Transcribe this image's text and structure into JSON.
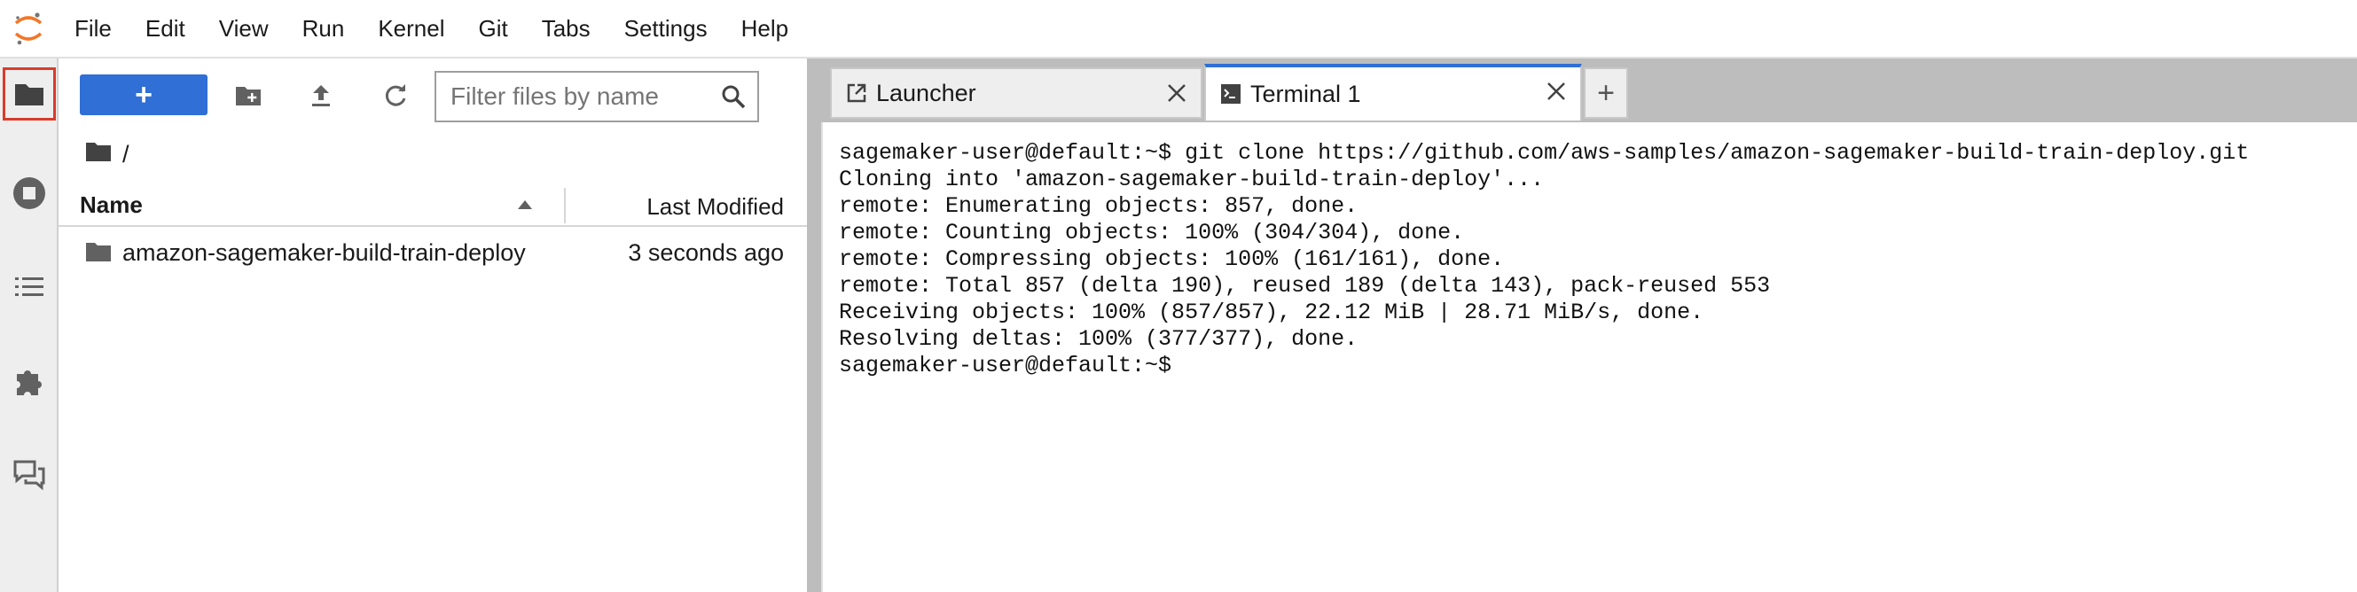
{
  "menu": [
    "File",
    "Edit",
    "View",
    "Run",
    "Kernel",
    "Git",
    "Tabs",
    "Settings",
    "Help"
  ],
  "colors": {
    "accent": "#2f6fd6",
    "highlight_box": "#d93b2b"
  },
  "activity_bar": {
    "items": [
      {
        "icon": "folder-icon",
        "active": true
      },
      {
        "icon": "stop-circle-icon",
        "active": false
      },
      {
        "icon": "list-icon",
        "active": false
      },
      {
        "icon": "puzzle-icon",
        "active": false
      },
      {
        "icon": "chat-icon",
        "active": false
      }
    ]
  },
  "file_browser": {
    "new_button_label": "+",
    "filter_placeholder": "Filter files by name",
    "breadcrumb": "/",
    "columns": {
      "name": "Name",
      "modified": "Last Modified"
    },
    "rows": [
      {
        "name": "amazon-sagemaker-build-train-deploy",
        "modified": "3 seconds ago",
        "type": "folder"
      }
    ]
  },
  "tabs": [
    {
      "label": "Launcher",
      "active": false,
      "icon": "launcher-icon"
    },
    {
      "label": "Terminal 1",
      "active": true,
      "icon": "terminal-icon"
    }
  ],
  "add_tab_label": "+",
  "terminal": {
    "lines": [
      "sagemaker-user@default:~$ git clone https://github.com/aws-samples/amazon-sagemaker-build-train-deploy.git",
      "Cloning into 'amazon-sagemaker-build-train-deploy'...",
      "remote: Enumerating objects: 857, done.",
      "remote: Counting objects: 100% (304/304), done.",
      "remote: Compressing objects: 100% (161/161), done.",
      "remote: Total 857 (delta 190), reused 189 (delta 143), pack-reused 553",
      "Receiving objects: 100% (857/857), 22.12 MiB | 28.71 MiB/s, done.",
      "Resolving deltas: 100% (377/377), done.",
      "sagemaker-user@default:~$"
    ]
  }
}
